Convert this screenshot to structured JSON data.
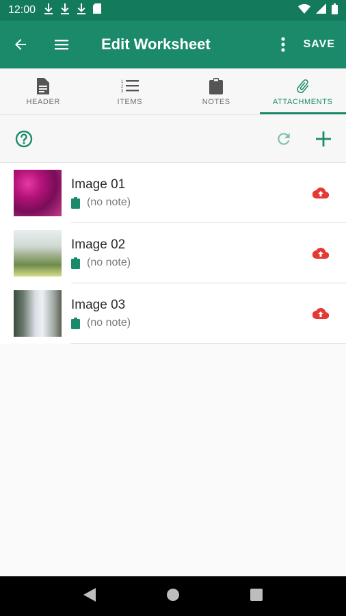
{
  "status_bar": {
    "time": "12:00",
    "left_icons": [
      "download-icon",
      "download-icon",
      "download-icon",
      "sd-card-icon"
    ],
    "right_icons": [
      "wifi-icon",
      "signal-icon",
      "battery-icon"
    ]
  },
  "app_bar": {
    "title": "Edit Worksheet",
    "save_label": "SAVE",
    "color": "#1a8a6a"
  },
  "tabs": [
    {
      "label": "HEADER",
      "icon": "document-icon",
      "active": false
    },
    {
      "label": "ITEMS",
      "icon": "numbered-list-icon",
      "active": false
    },
    {
      "label": "NOTES",
      "icon": "clipboard-icon",
      "active": false
    },
    {
      "label": "ATTACHMENTS",
      "icon": "paperclip-icon",
      "active": true
    }
  ],
  "toolbar": {
    "help_icon": "help-circle-icon",
    "refresh_icon": "refresh-icon",
    "add_icon": "plus-icon"
  },
  "attachments": [
    {
      "name": "Image 01",
      "note": "(no note)",
      "thumbnail": "flower-photo",
      "status_icon": "cloud-upload-icon"
    },
    {
      "name": "Image 02",
      "note": "(no note)",
      "thumbnail": "beach-photo",
      "status_icon": "cloud-upload-icon"
    },
    {
      "name": "Image 03",
      "note": "(no note)",
      "thumbnail": "waterfall-photo",
      "status_icon": "cloud-upload-icon"
    }
  ],
  "colors": {
    "accent": "#1a8a6a",
    "status_bar": "#137a5c",
    "upload_warning": "#e53935"
  }
}
